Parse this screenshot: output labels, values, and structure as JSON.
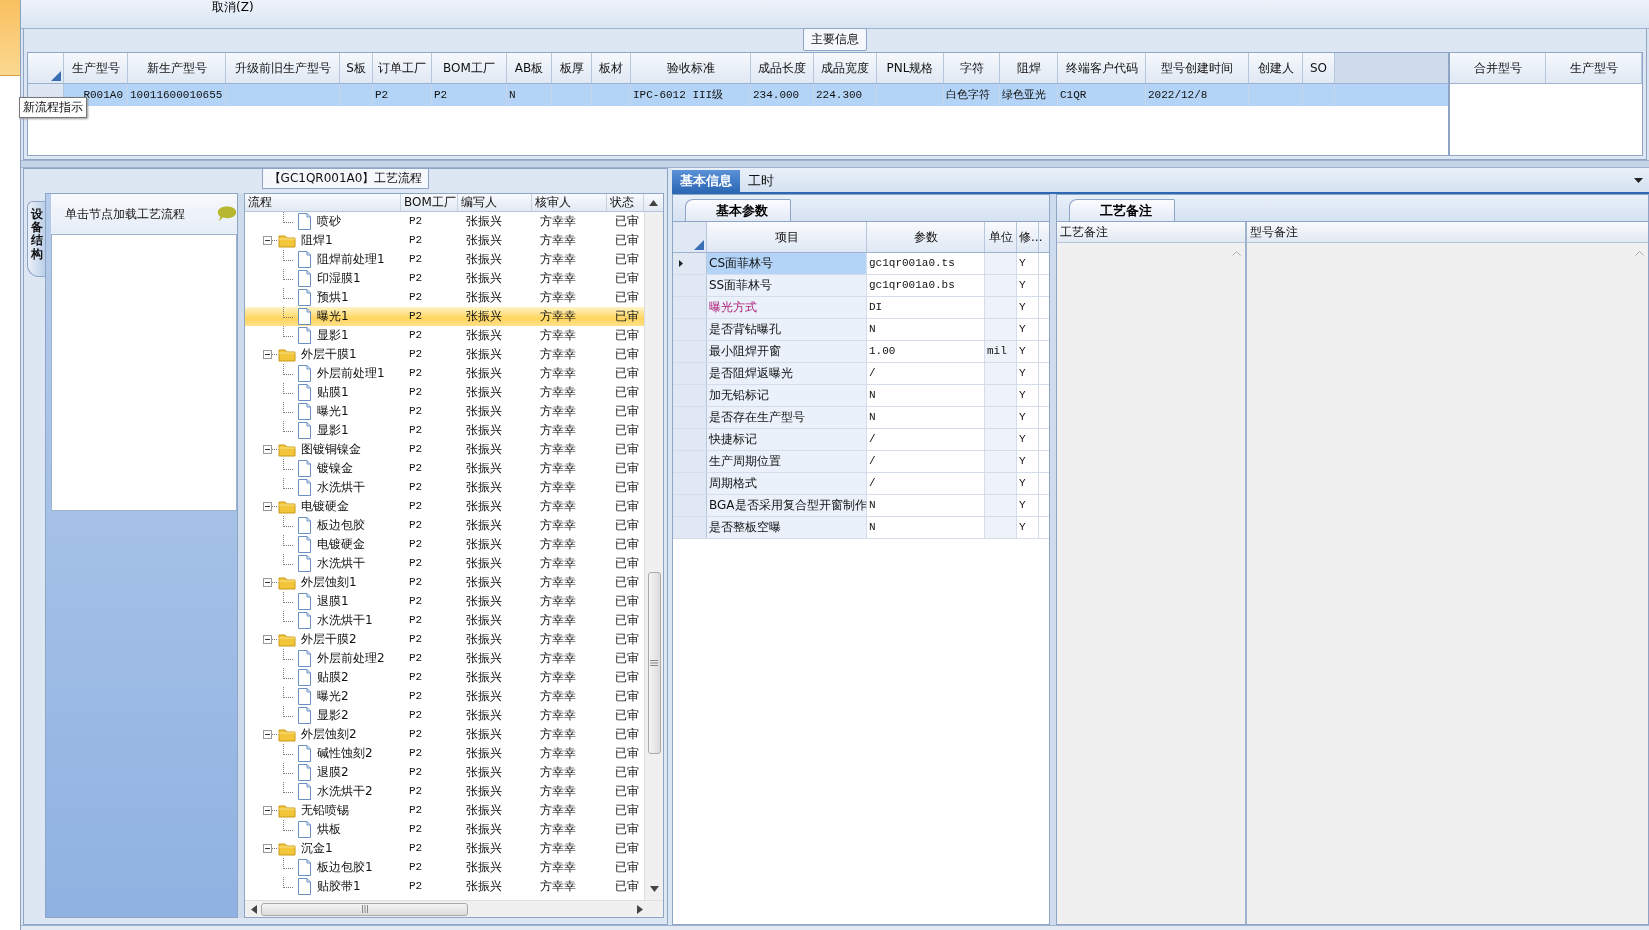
{
  "toolbar": {
    "buttons": [
      "取消(Z)"
    ]
  },
  "main_info": {
    "title": "主要信息",
    "tooltip": "新流程指示",
    "table": {
      "columns": [
        "生产型号",
        "新生产型号",
        "升级前旧生产型号",
        "S板",
        "订单工厂",
        "BOM工厂",
        "AB板",
        "板厚",
        "板材",
        "验收标准",
        "成品长度",
        "成品宽度",
        "PNL规格",
        "字符",
        "阻焊",
        "终端客户代码",
        "型号创建时间",
        "创建人",
        "SO"
      ],
      "rows": [
        {
          "selected": true,
          "cells": [
            "R001A0",
            "10011600010655",
            null,
            null,
            "P2",
            "P2",
            "N",
            null,
            null,
            "IPC-6012 III级",
            "234.000",
            "224.300",
            null,
            "白色字符",
            "绿色亚光",
            "C1QR",
            "2022/12/8",
            null,
            null
          ]
        }
      ]
    },
    "merge_table": {
      "columns": [
        "合并型号",
        "生产型号"
      ]
    }
  },
  "process_panel": {
    "title": "【GC1QR001A0】工艺流程",
    "side_tab": "设备结构",
    "hint": "单击节点加载工艺流程",
    "tree": {
      "columns": [
        "流程",
        "BOM工厂",
        "编写人",
        "核审人",
        "状态"
      ],
      "nodes": [
        {
          "children": [
            {
              "label": "喷砂",
              "bom": "P2",
              "writer": "张振兴",
              "reviewer": "方幸幸",
              "status": "已审",
              "selected": false
            }
          ]
        },
        {
          "label": "阻焊1",
          "bom": "P2",
          "writer": "张振兴",
          "reviewer": "方幸幸",
          "status": "已审",
          "selected": false,
          "expanded": true,
          "children": [
            {
              "label": "阻焊前处理1",
              "bom": "P2",
              "writer": "张振兴",
              "reviewer": "方幸幸",
              "status": "已审",
              "selected": false
            },
            {
              "label": "印湿膜1",
              "bom": "P2",
              "writer": "张振兴",
              "reviewer": "方幸幸",
              "status": "已审",
              "selected": false
            },
            {
              "label": "预烘1",
              "bom": "P2",
              "writer": "张振兴",
              "reviewer": "方幸幸",
              "status": "已审",
              "selected": false
            },
            {
              "label": "曝光1",
              "bom": "P2",
              "writer": "张振兴",
              "reviewer": "方幸幸",
              "status": "已审",
              "selected": true
            },
            {
              "label": "显影1",
              "bom": "P2",
              "writer": "张振兴",
              "reviewer": "方幸幸",
              "status": "已审",
              "selected": false
            }
          ]
        },
        {
          "label": "外层干膜1",
          "bom": "P2",
          "writer": "张振兴",
          "reviewer": "方幸幸",
          "status": "已审",
          "selected": false,
          "expanded": true,
          "children": [
            {
              "label": "外层前处理1",
              "bom": "P2",
              "writer": "张振兴",
              "reviewer": "方幸幸",
              "status": "已审",
              "selected": false
            },
            {
              "label": "贴膜1",
              "bom": "P2",
              "writer": "张振兴",
              "reviewer": "方幸幸",
              "status": "已审",
              "selected": false
            },
            {
              "label": "曝光1",
              "bom": "P2",
              "writer": "张振兴",
              "reviewer": "方幸幸",
              "status": "已审",
              "selected": false
            },
            {
              "label": "显影1",
              "bom": "P2",
              "writer": "张振兴",
              "reviewer": "方幸幸",
              "status": "已审",
              "selected": false
            }
          ]
        },
        {
          "label": "图镀铜镍金",
          "bom": "P2",
          "writer": "张振兴",
          "reviewer": "方幸幸",
          "status": "已审",
          "selected": false,
          "expanded": true,
          "children": [
            {
              "label": "镀镍金",
              "bom": "P2",
              "writer": "张振兴",
              "reviewer": "方幸幸",
              "status": "已审",
              "selected": false
            },
            {
              "label": "水洗烘干",
              "bom": "P2",
              "writer": "张振兴",
              "reviewer": "方幸幸",
              "status": "已审",
              "selected": false
            }
          ]
        },
        {
          "label": "电镀硬金",
          "bom": "P2",
          "writer": "张振兴",
          "reviewer": "方幸幸",
          "status": "已审",
          "selected": false,
          "expanded": true,
          "children": [
            {
              "label": "板边包胶",
              "bom": "P2",
              "writer": "张振兴",
              "reviewer": "方幸幸",
              "status": "已审",
              "selected": false
            },
            {
              "label": "电镀硬金",
              "bom": "P2",
              "writer": "张振兴",
              "reviewer": "方幸幸",
              "status": "已审",
              "selected": false
            },
            {
              "label": "水洗烘干",
              "bom": "P2",
              "writer": "张振兴",
              "reviewer": "方幸幸",
              "status": "已审",
              "selected": false
            }
          ]
        },
        {
          "label": "外层蚀刻1",
          "bom": "P2",
          "writer": "张振兴",
          "reviewer": "方幸幸",
          "status": "已审",
          "selected": false,
          "expanded": true,
          "children": [
            {
              "label": "退膜1",
              "bom": "P2",
              "writer": "张振兴",
              "reviewer": "方幸幸",
              "status": "已审",
              "selected": false
            },
            {
              "label": "水洗烘干1",
              "bom": "P2",
              "writer": "张振兴",
              "reviewer": "方幸幸",
              "status": "已审",
              "selected": false
            }
          ]
        },
        {
          "label": "外层干膜2",
          "bom": "P2",
          "writer": "张振兴",
          "reviewer": "方幸幸",
          "status": "已审",
          "selected": false,
          "expanded": true,
          "children": [
            {
              "label": "外层前处理2",
              "bom": "P2",
              "writer": "张振兴",
              "reviewer": "方幸幸",
              "status": "已审",
              "selected": false
            },
            {
              "label": "贴膜2",
              "bom": "P2",
              "writer": "张振兴",
              "reviewer": "方幸幸",
              "status": "已审",
              "selected": false
            },
            {
              "label": "曝光2",
              "bom": "P2",
              "writer": "张振兴",
              "reviewer": "方幸幸",
              "status": "已审",
              "selected": false
            },
            {
              "label": "显影2",
              "bom": "P2",
              "writer": "张振兴",
              "reviewer": "方幸幸",
              "status": "已审",
              "selected": false
            }
          ]
        },
        {
          "label": "外层蚀刻2",
          "bom": "P2",
          "writer": "张振兴",
          "reviewer": "方幸幸",
          "status": "已审",
          "selected": false,
          "expanded": true,
          "children": [
            {
              "label": "碱性蚀刻2",
              "bom": "P2",
              "writer": "张振兴",
              "reviewer": "方幸幸",
              "status": "已审",
              "selected": false
            },
            {
              "label": "退膜2",
              "bom": "P2",
              "writer": "张振兴",
              "reviewer": "方幸幸",
              "status": "已审",
              "selected": false
            },
            {
              "label": "水洗烘干2",
              "bom": "P2",
              "writer": "张振兴",
              "reviewer": "方幸幸",
              "status": "已审",
              "selected": false
            }
          ]
        },
        {
          "label": "无铅喷锡",
          "bom": "P2",
          "writer": "张振兴",
          "reviewer": "方幸幸",
          "status": "已审",
          "selected": false,
          "expanded": true,
          "children": [
            {
              "label": "烘板",
              "bom": "P2",
              "writer": "张振兴",
              "reviewer": "方幸幸",
              "status": "已审",
              "selected": false
            }
          ]
        },
        {
          "label": "沉金1",
          "bom": "P2",
          "writer": "张振兴",
          "reviewer": "方幸幸",
          "status": "已审",
          "selected": false,
          "expanded": true,
          "children": [
            {
              "label": "板边包胶1",
              "bom": "P2",
              "writer": "张振兴",
              "reviewer": "方幸幸",
              "status": "已审",
              "selected": false
            },
            {
              "label": "贴胶带1",
              "bom": "P2",
              "writer": "张振兴",
              "reviewer": "方幸幸",
              "status": "已审",
              "selected": false
            }
          ]
        }
      ]
    }
  },
  "detail_panel": {
    "tabs": [
      {
        "label": "基本信息",
        "selected": true
      },
      {
        "label": "工时",
        "selected": false
      }
    ],
    "params": {
      "tab": "基本参数",
      "columns": [
        "项目",
        "参数",
        "单位",
        "修..."
      ],
      "rows": [
        {
          "item": "CS面菲林号",
          "value": "gc1qr001a0.ts",
          "flag": "Y",
          "current": true,
          "emphasis": false
        },
        {
          "item": "SS面菲林号",
          "value": "gc1qr001a0.bs",
          "flag": "Y",
          "current": false,
          "emphasis": false
        },
        {
          "item": "曝光方式",
          "value": "DI",
          "flag": "Y",
          "current": false,
          "emphasis": true
        },
        {
          "item": "是否背钻曝孔",
          "value": "N",
          "flag": "Y",
          "current": false,
          "emphasis": false
        },
        {
          "item": "最小阻焊开窗",
          "value": "1.00",
          "unit": "mil",
          "flag": "Y",
          "current": false,
          "emphasis": false
        },
        {
          "item": "是否阻焊返曝光",
          "value": "/",
          "flag": "Y",
          "current": false,
          "emphasis": false
        },
        {
          "item": "加无铅标记",
          "value": "N",
          "flag": "Y",
          "current": false,
          "emphasis": false
        },
        {
          "item": "是否存在生产型号",
          "value": "N",
          "flag": "Y",
          "current": false,
          "emphasis": false
        },
        {
          "item": "快捷标记",
          "value": "/",
          "flag": "Y",
          "current": false,
          "emphasis": false
        },
        {
          "item": "生产周期位置",
          "value": "/",
          "flag": "Y",
          "current": false,
          "emphasis": false
        },
        {
          "item": "周期格式",
          "value": "/",
          "flag": "Y",
          "current": false,
          "emphasis": false
        },
        {
          "item": "BGA是否采用复合型开窗制作",
          "value": "N",
          "flag": "Y",
          "current": false,
          "emphasis": false
        },
        {
          "item": "是否整板空曝",
          "value": "N",
          "flag": "Y",
          "current": false,
          "emphasis": false
        }
      ]
    },
    "notes": {
      "tab": "工艺备注",
      "columns": [
        "工艺备注",
        "型号备注"
      ]
    }
  }
}
